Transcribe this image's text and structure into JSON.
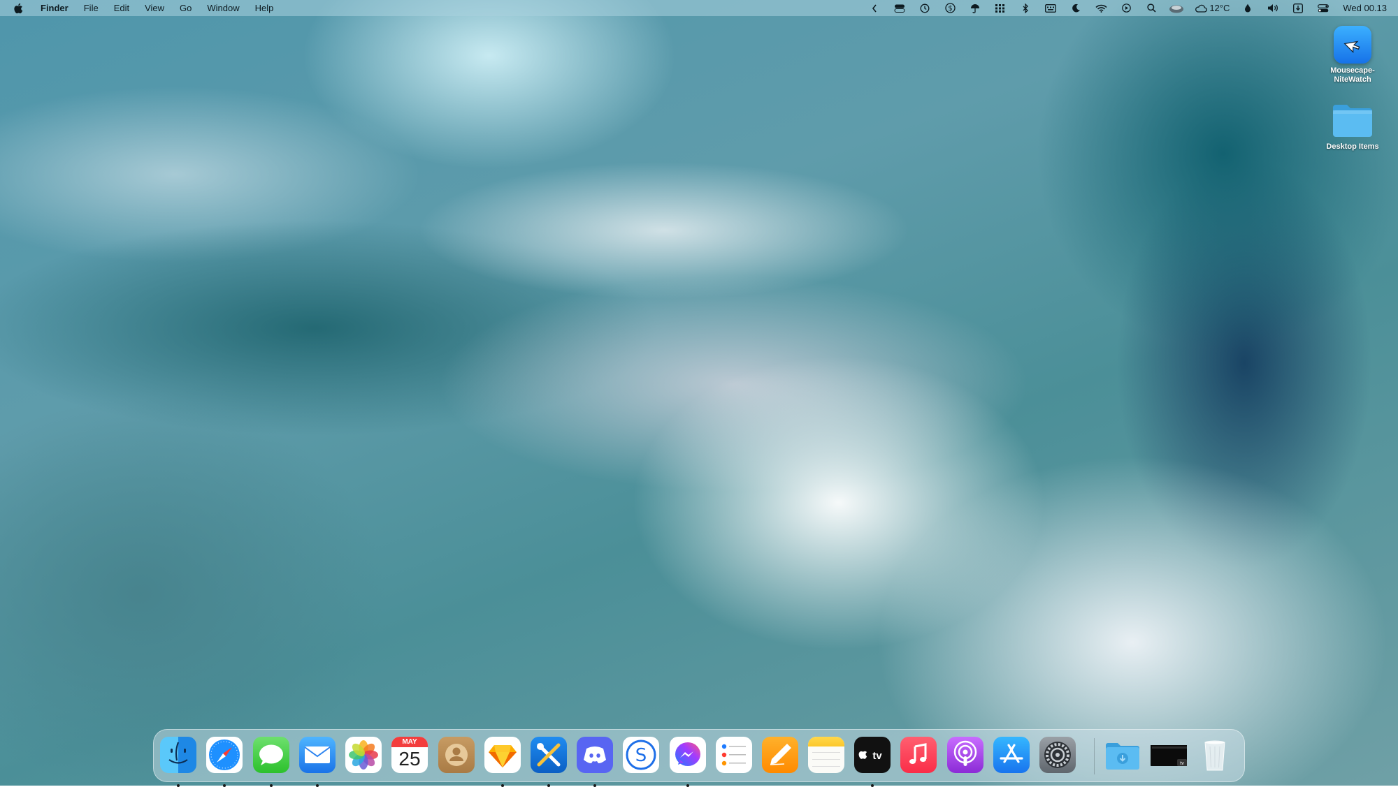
{
  "menubar": {
    "app_name": "Finder",
    "menus": [
      "File",
      "Edit",
      "View",
      "Go",
      "Window",
      "Help"
    ],
    "status_icons": [
      "chevron-left-icon",
      "toggle-icon",
      "time-machine-icon",
      "currency-icon",
      "umbrella-icon",
      "grid-icon",
      "bluetooth-icon",
      "keyboard-icon",
      "moon-icon",
      "wifi-icon",
      "play-icon",
      "search-icon",
      "weather-app-icon"
    ],
    "weather": "12°C",
    "trailing_icons": [
      "drop-icon",
      "volume-icon",
      "download-icon",
      "control-center-icon"
    ],
    "clock": "Wed 00.13"
  },
  "desktop": {
    "items": [
      {
        "label": "Mousecape-NiteWatch",
        "icon": "mousecape-app-icon"
      },
      {
        "label": "Desktop Items",
        "icon": "folder-icon"
      }
    ]
  },
  "dock": {
    "apps": [
      {
        "name": "Finder",
        "running": true
      },
      {
        "name": "Safari",
        "running": true
      },
      {
        "name": "Messages",
        "running": true
      },
      {
        "name": "Mail",
        "running": true
      },
      {
        "name": "Photos",
        "running": false
      },
      {
        "name": "Calendar",
        "running": false
      },
      {
        "name": "Contacts",
        "running": false
      },
      {
        "name": "Sketch",
        "running": true
      },
      {
        "name": "Xcode Tools",
        "running": true
      },
      {
        "name": "Discord",
        "running": true
      },
      {
        "name": "Shazam",
        "running": false
      },
      {
        "name": "Messenger",
        "running": true
      },
      {
        "name": "Reminders",
        "running": false
      },
      {
        "name": "Pages",
        "running": false
      },
      {
        "name": "Notes",
        "running": false
      },
      {
        "name": "Apple TV",
        "running": true
      },
      {
        "name": "Music",
        "running": false
      },
      {
        "name": "Podcasts",
        "running": false
      },
      {
        "name": "App Store",
        "running": false
      },
      {
        "name": "System Settings",
        "running": false
      }
    ],
    "calendar": {
      "month": "MAY",
      "day": "25"
    },
    "tv_label": "tv",
    "stacks": [
      "Downloads",
      "Screen Recording",
      "Trash"
    ]
  },
  "colors": {
    "menubar_text": "#0d1a20",
    "accent_blue": "#1672e8",
    "folder_blue": "#4fb3ec"
  }
}
